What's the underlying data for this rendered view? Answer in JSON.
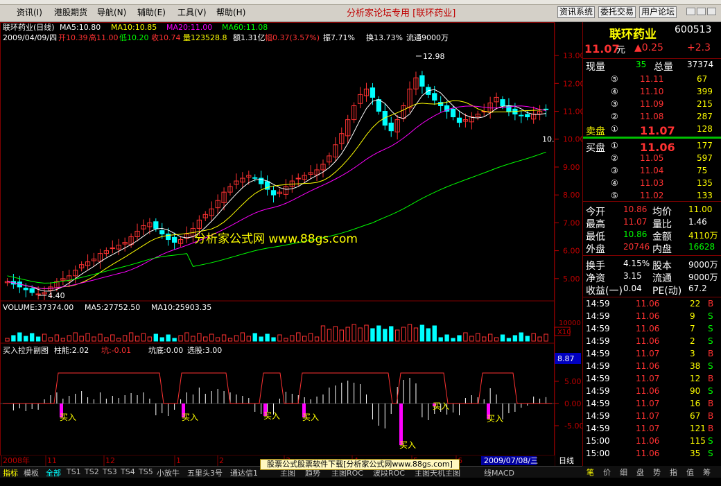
{
  "menu": {
    "items": [
      "资讯(I)",
      "港股期货",
      "导航(N)",
      "辅助(E)",
      "工具(V)",
      "帮助(H)"
    ],
    "brand_title": "分析家论坛专用 [联环药业]",
    "right_buttons": [
      "资讯系统",
      "委托交易",
      "用户论坛"
    ]
  },
  "chart_header": {
    "line1_name": "联环药业(日线)",
    "ma5": "MA5:10.80",
    "ma10": "MA10:10.85",
    "ma20": "MA20:11.00",
    "ma60": "MA60:11.08",
    "line2_date": "2009/04/09/四",
    "open": "开10.39",
    "high": "高11.00",
    "low": "低10.20",
    "close": "收10.74",
    "vol": "量123528.8",
    "amount": "额1.31亿",
    "change": "幅0.37(3.57%)",
    "amplitude": "振7.71%",
    "turnover": "换13.73%",
    "float": "流通9000万",
    "peak_label": "12.98",
    "trough_label": "4.40",
    "watermark": "分析家公式网 www.88gs.com",
    "last_price_tag": "10."
  },
  "price_axis": {
    "ticks": [
      "13.00",
      "12.00",
      "11.00",
      "10.00",
      "9.00",
      "8.00",
      "7.00",
      "6.00",
      "5.00"
    ]
  },
  "volume_panel": {
    "title": "VOLUME:37374.00",
    "ma5": "MA5:27752.50",
    "ma10": "MA10:25903.35",
    "axis_label": "10000",
    "unit": "X10"
  },
  "indicator_panel": {
    "title": "买入拉升副图",
    "zhuneng": "柱能:2.02",
    "keng": "坑:-0.01",
    "kengdi": "坑底:0.00",
    "xuangu": "选股:3.00",
    "axis_ticks": [
      "5.00",
      "0.00",
      "-5.00"
    ],
    "current_value": "8.87",
    "buy_label": "买入"
  },
  "time_axis": {
    "labels": [
      "2008年",
      "11",
      "12",
      "1",
      "2",
      "3",
      "4",
      "5",
      "6"
    ],
    "cursor_date": "2009/07/08/三",
    "period": "日线"
  },
  "bottom_tabs": [
    "指标",
    "模板",
    "全部",
    "TS1",
    "TS2",
    "TS3",
    "TS4",
    "TS5",
    "小放牛",
    "五里头3号",
    "通达信1",
    "主图",
    "趋势",
    "主图ROC",
    "波段ROC",
    "主图天机主图",
    "线MACD"
  ],
  "bottom_banner": "股票公式股票软件下载[分析家公式网www.88gs.com]",
  "right_tabs": [
    "笔",
    "价",
    "细",
    "盘",
    "势",
    "指",
    "值",
    "筹"
  ],
  "quote": {
    "name": "联环药业",
    "code": "600513",
    "price": "11.07",
    "unit": "元",
    "change": "▲0.25",
    "change_pct": "+2.3",
    "cur_vol_label": "现量",
    "cur_vol": "35",
    "total_vol_label": "总量",
    "total_vol": "37374",
    "sell_label": "卖盘",
    "buy_label": "买盘",
    "asks": [
      {
        "level": "⑤",
        "price": "11.11",
        "vol": "67"
      },
      {
        "level": "④",
        "price": "11.10",
        "vol": "399"
      },
      {
        "level": "③",
        "price": "11.09",
        "vol": "215"
      },
      {
        "level": "②",
        "price": "11.08",
        "vol": "287"
      },
      {
        "level": "①",
        "price": "11.07",
        "vol": "128"
      }
    ],
    "bids": [
      {
        "level": "①",
        "price": "11.06",
        "vol": "177"
      },
      {
        "level": "②",
        "price": "11.05",
        "vol": "597"
      },
      {
        "level": "③",
        "price": "11.04",
        "vol": "75"
      },
      {
        "level": "④",
        "price": "11.03",
        "vol": "135"
      },
      {
        "level": "⑤",
        "price": "11.02",
        "vol": "133"
      }
    ],
    "stats": [
      {
        "l1": "今开",
        "v1": "10.86",
        "l2": "均价",
        "v2": "11.00"
      },
      {
        "l1": "最高",
        "v1": "11.07",
        "l2": "量比",
        "v2": "1.46"
      },
      {
        "l1": "最低",
        "v1": "10.86",
        "l2": "金额",
        "v2": "4110万"
      },
      {
        "l1": "外盘",
        "v1": "20746",
        "l2": "内盘",
        "v2": "16628"
      }
    ],
    "fundamentals": [
      {
        "l1": "换手",
        "v1": "4.15%",
        "l2": "股本",
        "v2": "9000万"
      },
      {
        "l1": "净资",
        "v1": "3.15",
        "l2": "流通",
        "v2": "9000万"
      },
      {
        "l1": "收益(一)",
        "v1": "0.04",
        "l2": "PE(动)",
        "v2": "67.2"
      }
    ],
    "ticks": [
      {
        "t": "14:59",
        "p": "11.06",
        "v": "22",
        "s": "B"
      },
      {
        "t": "14:59",
        "p": "11.06",
        "v": "9",
        "s": "S"
      },
      {
        "t": "14:59",
        "p": "11.06",
        "v": "7",
        "s": "S"
      },
      {
        "t": "14:59",
        "p": "11.06",
        "v": "2",
        "s": "S"
      },
      {
        "t": "14:59",
        "p": "11.07",
        "v": "3",
        "s": "B"
      },
      {
        "t": "14:59",
        "p": "11.06",
        "v": "38",
        "s": "S"
      },
      {
        "t": "14:59",
        "p": "11.07",
        "v": "12",
        "s": "B"
      },
      {
        "t": "14:59",
        "p": "11.06",
        "v": "90",
        "s": "S"
      },
      {
        "t": "14:59",
        "p": "11.07",
        "v": "16",
        "s": "B"
      },
      {
        "t": "14:59",
        "p": "11.07",
        "v": "67",
        "s": "B"
      },
      {
        "t": "14:59",
        "p": "11.07",
        "v": "121",
        "s": "B"
      },
      {
        "t": "15:00",
        "p": "11.06",
        "v": "115",
        "s": "S"
      },
      {
        "t": "15:00",
        "p": "11.06",
        "v": "35",
        "s": "S"
      }
    ]
  },
  "chart_data": {
    "type": "candlestick",
    "x_range": [
      "2008-10",
      "2009-07"
    ],
    "ylim": [
      4.2,
      13.4
    ],
    "close_series": [
      4.9,
      4.8,
      4.7,
      4.6,
      4.5,
      4.45,
      4.5,
      4.7,
      4.9,
      5.0,
      5.1,
      5.3,
      5.5,
      5.6,
      5.7,
      5.9,
      6.0,
      6.1,
      6.2,
      6.3,
      6.5,
      6.7,
      6.9,
      7.0,
      6.8,
      6.6,
      6.4,
      6.3,
      6.4,
      6.6,
      6.8,
      7.1,
      7.3,
      7.5,
      7.8,
      8.1,
      8.3,
      8.5,
      8.6,
      8.7,
      8.6,
      8.4,
      8.2,
      8.0,
      8.1,
      8.3,
      8.5,
      8.6,
      8.7,
      8.8,
      8.9,
      9.1,
      9.4,
      9.8,
      10.2,
      10.7,
      11.2,
      11.6,
      11.8,
      11.5,
      11.0,
      10.5,
      10.3,
      10.7,
      11.2,
      11.8,
      12.2,
      11.9,
      11.6,
      11.4,
      11.2,
      11.0,
      10.8,
      10.6,
      10.7,
      10.8,
      10.9,
      11.0,
      11.3,
      11.5,
      11.2,
      11.0,
      10.9,
      10.85,
      10.8,
      10.9,
      11.0,
      11.07
    ],
    "peak": 12.98,
    "trough": 4.4,
    "ma_colors": {
      "ma5": "#ffffff",
      "ma10": "#ffff00",
      "ma20": "#ff00ff",
      "ma60": "#00ff00"
    },
    "up_color": "#ff3232",
    "down_color": "#00ffff"
  }
}
